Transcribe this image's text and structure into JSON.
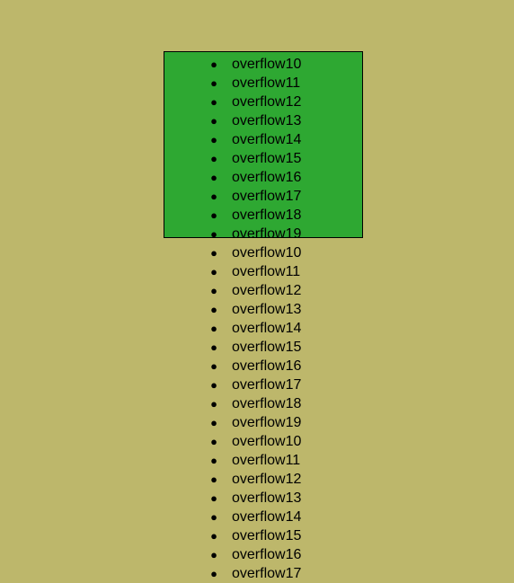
{
  "items": [
    "overflow10",
    "overflow11",
    "overflow12",
    "overflow13",
    "overflow14",
    "overflow15",
    "overflow16",
    "overflow17",
    "overflow18",
    "overflow19",
    "overflow10",
    "overflow11",
    "overflow12",
    "overflow13",
    "overflow14",
    "overflow15",
    "overflow16",
    "overflow17",
    "overflow18",
    "overflow19",
    "overflow10",
    "overflow11",
    "overflow12",
    "overflow13",
    "overflow14",
    "overflow15",
    "overflow16",
    "overflow17"
  ]
}
